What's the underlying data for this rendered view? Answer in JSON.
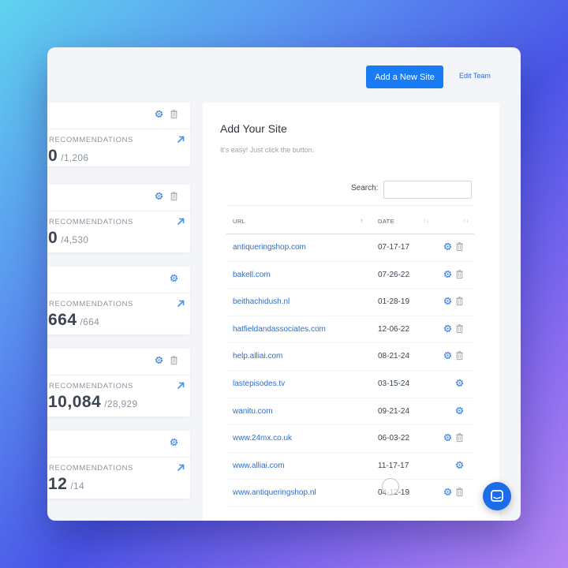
{
  "header": {
    "add_site_label": "Add a New Site",
    "edit_team_label": "Edit Team"
  },
  "cards": [
    {
      "label": "RECOMMENDATIONS",
      "value": "0",
      "total": "/1,206",
      "has_trash": true
    },
    {
      "label": "RECOMMENDATIONS",
      "value": "0",
      "total": "/4,530",
      "has_trash": true
    },
    {
      "label": "RECOMMENDATIONS",
      "value": "664",
      "total": "/664",
      "has_trash": false
    },
    {
      "label": "RECOMMENDATIONS",
      "value": "10,084",
      "total": "/28,929",
      "has_trash": true
    },
    {
      "label": "RECOMMENDATIONS",
      "value": "12",
      "total": "/14",
      "has_trash": false
    }
  ],
  "panel": {
    "title": "Add Your Site",
    "subtitle": "It's easy! Just click the button.",
    "search_label": "Search:",
    "search_value": ""
  },
  "table": {
    "columns": {
      "url": "URL",
      "date": "DATE"
    },
    "sort_up": "↑",
    "sort_both": "↑↓",
    "rows": [
      {
        "url": "antiqueringshop.com",
        "date": "07-17-17",
        "has_trash": true
      },
      {
        "url": "bakell.com",
        "date": "07-26-22",
        "has_trash": true
      },
      {
        "url": "beithachidush.nl",
        "date": "01-28-19",
        "has_trash": true
      },
      {
        "url": "hatfieldandassociates.com",
        "date": "12-06-22",
        "has_trash": true
      },
      {
        "url": "help.alliai.com",
        "date": "08-21-24",
        "has_trash": true
      },
      {
        "url": "lastepisodes.tv",
        "date": "03-15-24",
        "has_trash": false
      },
      {
        "url": "wanitu.com",
        "date": "09-21-24",
        "has_trash": false
      },
      {
        "url": "www.24mx.co.uk",
        "date": "06-03-22",
        "has_trash": true
      },
      {
        "url": "www.alliai.com",
        "date": "11-17-17",
        "has_trash": false
      },
      {
        "url": "www.antiqueringshop.nl",
        "date": "04-12-19",
        "has_trash": true
      }
    ]
  },
  "colors": {
    "accent": "#1a7cf4",
    "link": "#2a6fd0",
    "icon": "#4a8de6",
    "trash": "#a9b1ba"
  },
  "icons": {
    "gear": "gear-icon",
    "trash": "trash-icon",
    "arrow": "arrow-up-right-icon",
    "chat": "chat-icon"
  }
}
